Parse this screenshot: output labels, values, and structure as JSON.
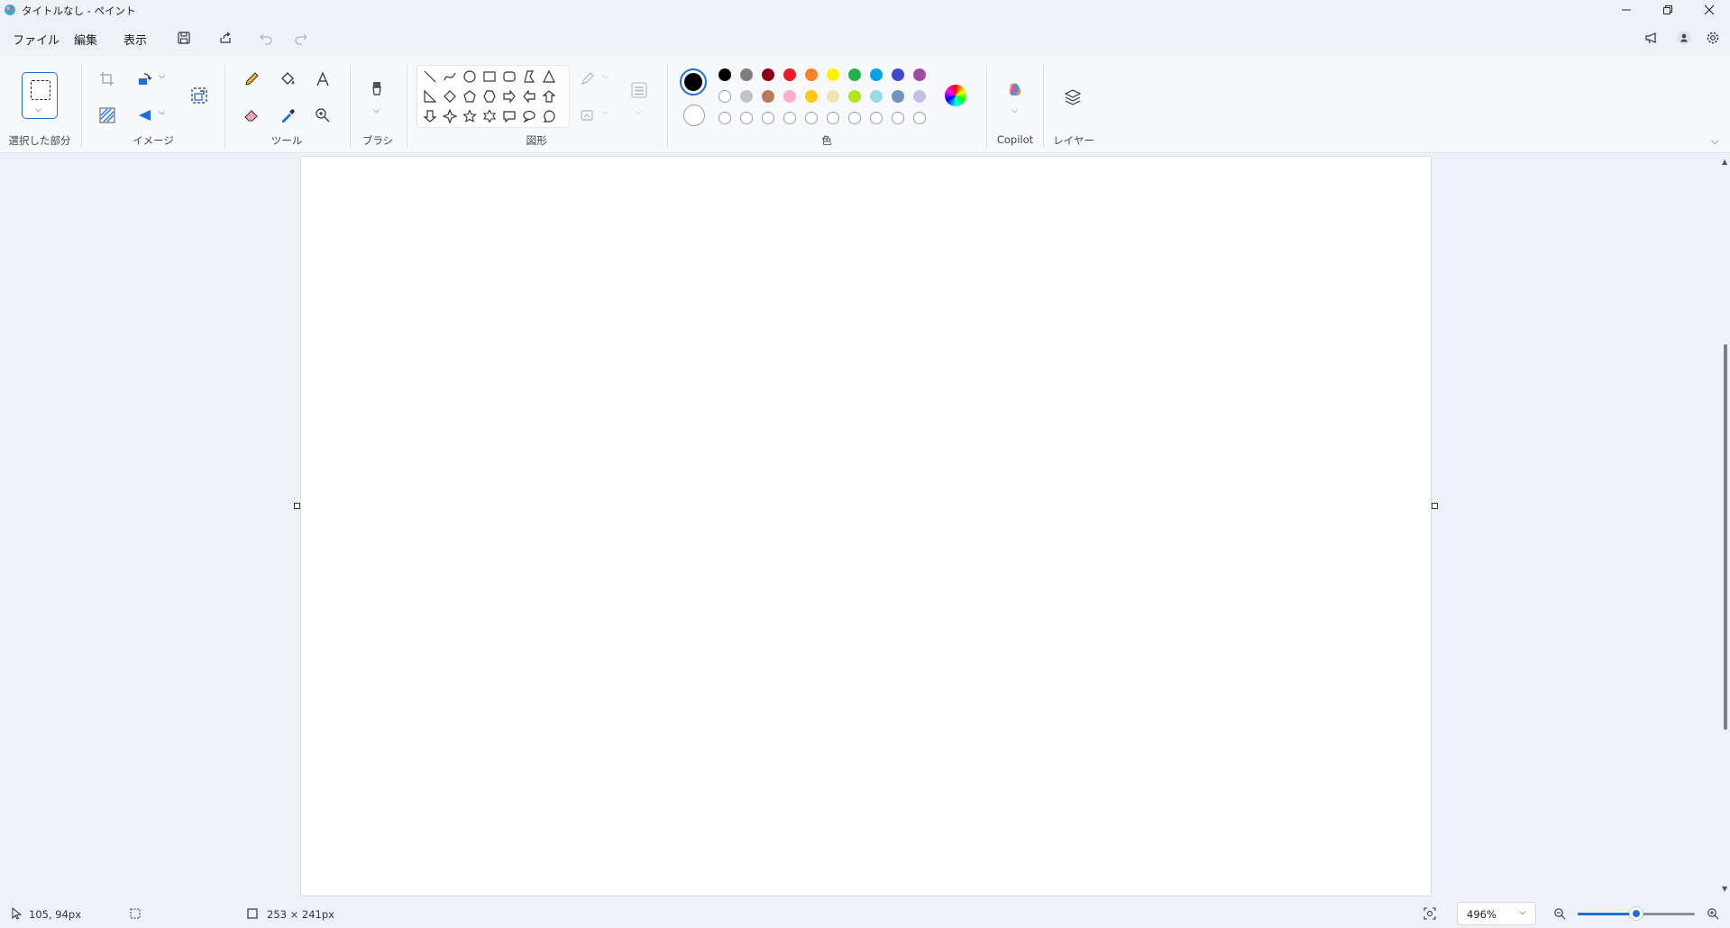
{
  "window": {
    "title": "タイトルなし - ペイント"
  },
  "menu": {
    "file": "ファイル",
    "edit": "編集",
    "view": "表示"
  },
  "ribbon": {
    "groups": {
      "selection": "選択した部分",
      "image": "イメージ",
      "tools": "ツール",
      "brushes": "ブラシ",
      "shapes": "図形",
      "colors": "色",
      "copilot": "Copilot",
      "layers": "レイヤー"
    },
    "palette_row1": [
      "#000000",
      "#7f7f7f",
      "#880015",
      "#ed1c24",
      "#ff7f27",
      "#fff200",
      "#22b14c",
      "#00a2e8",
      "#3f48cc",
      "#a349a4"
    ],
    "palette_row2": [
      "#ffffff",
      "#c3c3c3",
      "#b97a57",
      "#ffaec9",
      "#ffc90e",
      "#efe4b0",
      "#b5e61d",
      "#99d9ea",
      "#7092be",
      "#c8bfe7"
    ],
    "primary_color": "#000000",
    "secondary_color": "#ffffff"
  },
  "status": {
    "cursor_position": "105, 94px",
    "canvas_size": "253 × 241px",
    "zoom": "496%"
  },
  "colors": {
    "accent": "#1e6fd9",
    "background": "#eef2f8"
  }
}
